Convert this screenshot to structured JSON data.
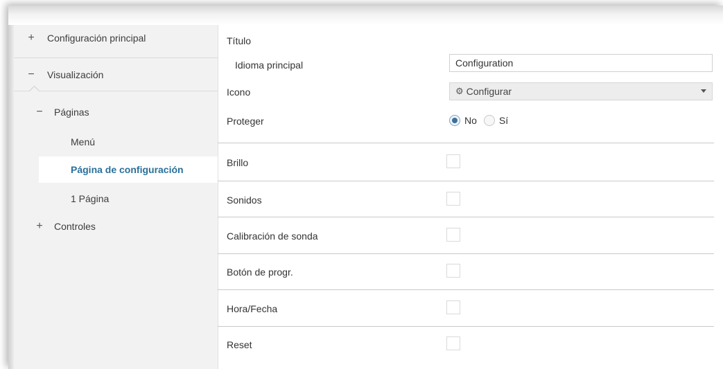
{
  "sidebar": {
    "items": [
      {
        "symbol": "+",
        "label": "Configuración principal"
      },
      {
        "symbol": "−",
        "label": "Visualización"
      },
      {
        "symbol": "−",
        "label": "Páginas"
      },
      {
        "symbol": "",
        "label": "Menú"
      },
      {
        "symbol": "",
        "label": "Página de configuración"
      },
      {
        "symbol": "",
        "label": "1 Página"
      },
      {
        "symbol": "+",
        "label": "Controles"
      }
    ],
    "active_item": "Página de configuración"
  },
  "main": {
    "title_label": "Título",
    "language": {
      "label": "Idioma principal",
      "value": "Configuration"
    },
    "icon": {
      "label": "Icono",
      "icon_name": "gear-icon",
      "glyph": "⚙",
      "selected": "Configurar"
    },
    "protect": {
      "label": "Proteger",
      "options": [
        "No",
        "Sí"
      ],
      "selected": "No"
    },
    "checkboxes": [
      {
        "label": "Brillo",
        "checked": false
      },
      {
        "label": "Sonidos",
        "checked": false
      },
      {
        "label": "Calibración de sonda",
        "checked": false
      },
      {
        "label": "Botón de progr.",
        "checked": false
      },
      {
        "label": "Hora/Fecha",
        "checked": false
      },
      {
        "label": "Reset",
        "checked": false
      }
    ]
  },
  "colors": {
    "active_text": "#2a6f9a",
    "sidebar_bg": "#f2f2f2",
    "radio_selected": "#3f6f9a"
  }
}
